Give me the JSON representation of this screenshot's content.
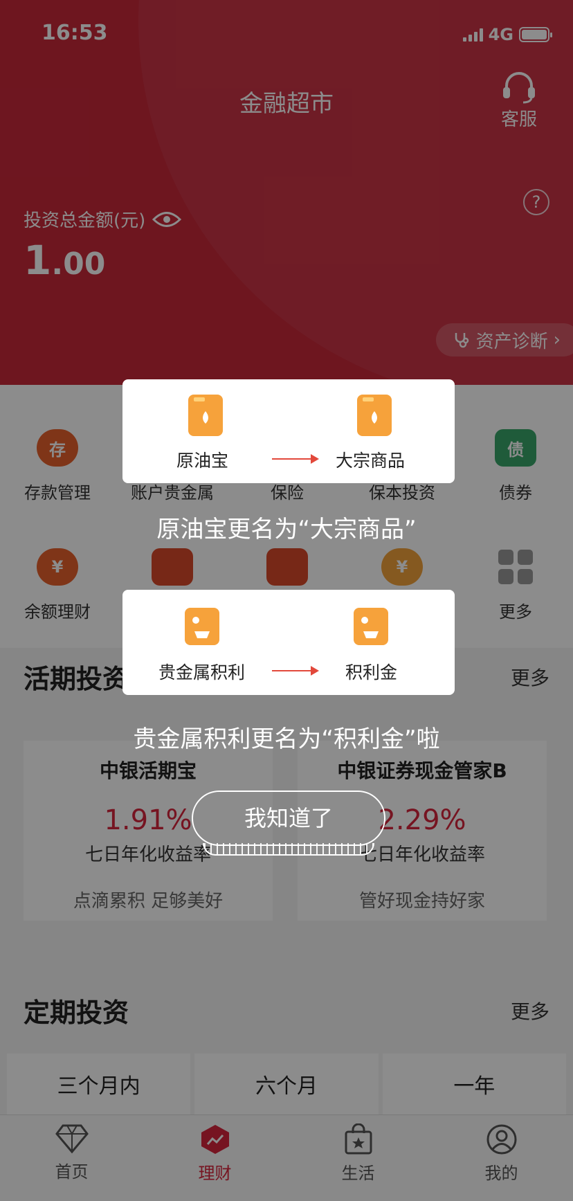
{
  "status": {
    "time": "16:53",
    "network": "4G"
  },
  "header": {
    "title": "金融超市",
    "service_label": "客服",
    "help": "?",
    "total_label": "投资总金额(元)",
    "total_value_int": "1",
    "total_value_dec": ".00",
    "diagnosis": "资产诊断"
  },
  "grid": [
    {
      "label": "存款管理",
      "icon": "piggy-bank-icon",
      "glyph": "存",
      "color": "#e8622c"
    },
    {
      "label": "账户贵金属",
      "icon": "gold-bar-icon",
      "glyph": "",
      "color": "#f29a2e"
    },
    {
      "label": "保险",
      "icon": "umbrella-icon",
      "glyph": "",
      "color": "#e85a2c"
    },
    {
      "label": "保本投资",
      "icon": "shield-icon",
      "glyph": "",
      "color": "#e8622c"
    },
    {
      "label": "债券",
      "icon": "bond-ticket-icon",
      "glyph": "债",
      "color": "#3aa66b"
    },
    {
      "label": "余额理财",
      "icon": "money-bag-icon",
      "glyph": "¥",
      "color": "#e8622c"
    },
    {
      "label": "",
      "icon": "bull-icon",
      "glyph": "",
      "color": "#d94a2a"
    },
    {
      "label": "",
      "icon": "rising-chart-icon",
      "glyph": "",
      "color": "#d94a2a"
    },
    {
      "label": "",
      "icon": "coin-bag-icon",
      "glyph": "¥",
      "color": "#f2a23b"
    },
    {
      "label": "更多",
      "icon": "more-grid-icon",
      "glyph": "",
      "color": "#9a9a9a"
    }
  ],
  "current": {
    "title": "活期投资",
    "more": "更多",
    "products": [
      {
        "name": "中银活期宝",
        "rate": "1.91%",
        "rate_label": "七日年化收益率",
        "desc": "点滴累积 足够美好"
      },
      {
        "name": "中银证券现金管家B",
        "rate": "2.29%",
        "rate_label": "七日年化收益率",
        "desc": "管好现金持好家"
      }
    ]
  },
  "fixed": {
    "title": "定期投资",
    "more": "更多",
    "tabs": [
      "三个月内",
      "六个月",
      "一年"
    ]
  },
  "tabbar": [
    {
      "label": "首页",
      "icon": "diamond-icon"
    },
    {
      "label": "理财",
      "icon": "trend-up-icon",
      "active": true
    },
    {
      "label": "生活",
      "icon": "shopping-bag-icon"
    },
    {
      "label": "我的",
      "icon": "user-icon"
    }
  ],
  "overlay": {
    "popup1": {
      "from": "原油宝",
      "to": "大宗商品",
      "caption": "原油宝更名为“大宗商品”"
    },
    "popup2": {
      "from": "贵金属积利",
      "to": "积利金",
      "caption": "贵金属积利更名为“积利金”啦"
    },
    "ok_button": "我知道了"
  },
  "colors": {
    "brand_red": "#c8283a",
    "rate_red": "#d7263d",
    "icon_orange": "#f6a23b"
  }
}
